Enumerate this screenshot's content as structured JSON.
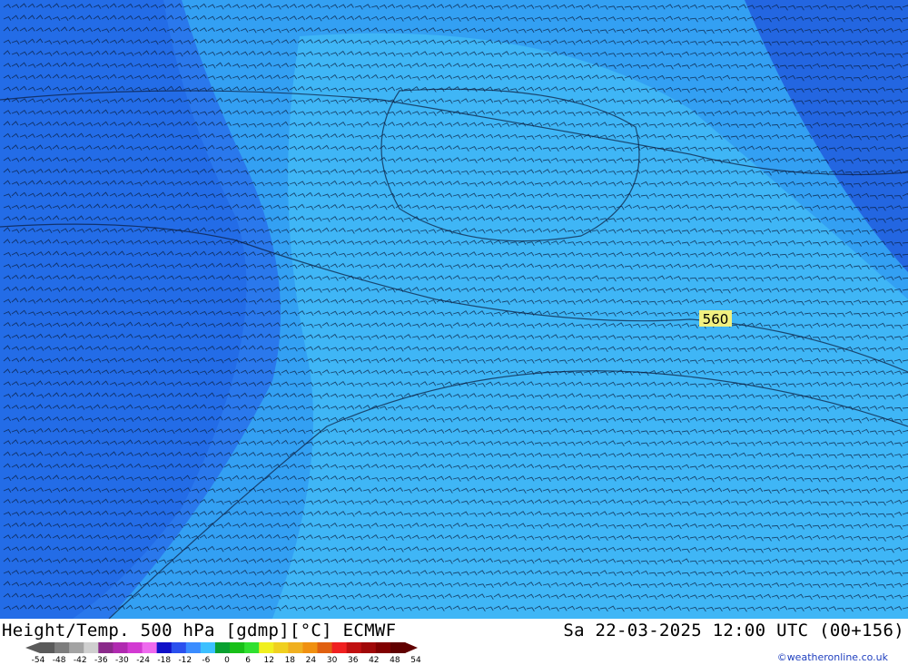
{
  "map": {
    "contour_label": "560",
    "field_colors": {
      "deep": "#1f5fe0",
      "mid": "#2f86f0",
      "light": "#3fb3f5",
      "lightest": "#45c2f7",
      "outline": "#0a1a3a",
      "label_bg": "#f0f080"
    }
  },
  "footer": {
    "title_left": "Height/Temp. 500 hPa [gdmp][°C] ECMWF",
    "title_right": "Sa 22-03-2025 12:00 UTC (00+156)",
    "credit": "©weatheronline.co.uk",
    "scale_ticks": [
      "-54",
      "-48",
      "-42",
      "-36",
      "-30",
      "-24",
      "-18",
      "-12",
      "-6",
      "0",
      "6",
      "12",
      "18",
      "24",
      "30",
      "36",
      "42",
      "48",
      "54"
    ],
    "scale_colors": [
      "#5a5a5a",
      "#7d7d7d",
      "#a3a3a3",
      "#cfcfcf",
      "#8a2a8a",
      "#b02ab0",
      "#d23ad2",
      "#ee6aee",
      "#1010c8",
      "#2a50ee",
      "#3a8cff",
      "#3cc0ff",
      "#08a030",
      "#18c018",
      "#30e030",
      "#f0f020",
      "#f0d020",
      "#f0b020",
      "#f09010",
      "#e06010",
      "#f02020",
      "#c01010",
      "#a00808",
      "#800000",
      "#600000"
    ]
  }
}
